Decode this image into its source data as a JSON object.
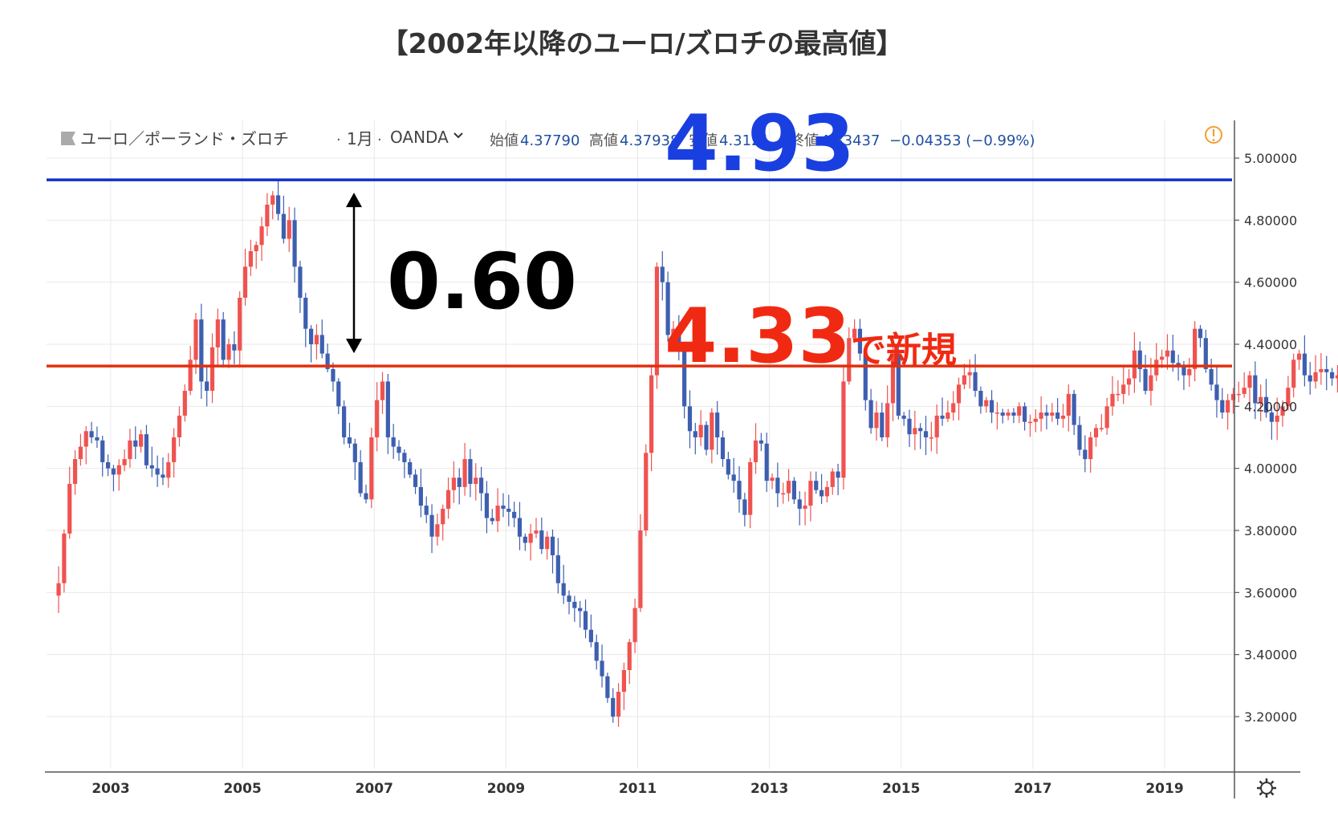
{
  "title": "【2002年以降のユーロ/ズロチの最高値】",
  "header": {
    "symbol": "ユーロ／ポーランド・ズロチ",
    "interval": "1月",
    "source": "OANDA",
    "open_label": "始値",
    "open_value": "4.37790",
    "high_label": "高値",
    "high_value": "4.37938",
    "low_label": "安値",
    "low_value": "4.3121",
    "close_label": "終値",
    "close_value": "4.33437",
    "change": "−0.04353 (−0.99%)"
  },
  "annotations": {
    "high_value": "4.93",
    "diff_value": "0.60",
    "current_value": "4.33",
    "current_suffix": "で新規"
  },
  "colors": {
    "up": "#ef5350",
    "down": "#3e5fb0",
    "high_line": "#1230c8",
    "current_line": "#e03010",
    "axis": "#555555",
    "grid": "#e8e8e8",
    "warning": "#f0a030"
  },
  "icons": {
    "warning": "warning-icon",
    "settings": "gear-icon",
    "flag": "flag-icon",
    "dropdown": "chevron-down-icon"
  },
  "chart_data": {
    "type": "candlestick",
    "interval": "monthly",
    "x_ticks": [
      "2003",
      "2005",
      "2007",
      "2009",
      "2011",
      "2013",
      "2015",
      "2017",
      "2019"
    ],
    "y_ticks": [
      "5.00000",
      "4.80000",
      "4.60000",
      "4.40000",
      "4.20000",
      "4.00000",
      "3.80000",
      "3.60000",
      "3.40000",
      "3.20000"
    ],
    "ylim": [
      3.05,
      5.05
    ],
    "xlim": [
      2001.6,
      2020.3
    ],
    "reference_lines": [
      {
        "value": 4.93,
        "color": "blue"
      },
      {
        "value": 4.33,
        "color": "red"
      }
    ],
    "start": "2002-03",
    "closes": [
      3.63,
      3.79,
      3.95,
      4.03,
      4.07,
      4.12,
      4.1,
      4.09,
      4.02,
      4.0,
      3.98,
      4.01,
      4.03,
      4.09,
      4.07,
      4.11,
      4.01,
      4.0,
      3.98,
      3.97,
      4.02,
      4.1,
      4.17,
      4.25,
      4.35,
      4.48,
      4.28,
      4.25,
      4.39,
      4.48,
      4.35,
      4.4,
      4.38,
      4.55,
      4.65,
      4.7,
      4.72,
      4.78,
      4.85,
      4.88,
      4.82,
      4.74,
      4.8,
      4.65,
      4.55,
      4.45,
      4.4,
      4.43,
      4.37,
      4.32,
      4.28,
      4.2,
      4.1,
      4.08,
      4.02,
      3.92,
      3.9,
      4.1,
      4.22,
      4.28,
      4.1,
      4.07,
      4.05,
      4.02,
      3.98,
      3.94,
      3.88,
      3.85,
      3.78,
      3.82,
      3.87,
      3.93,
      3.97,
      3.94,
      4.03,
      3.95,
      3.97,
      3.92,
      3.84,
      3.83,
      3.88,
      3.87,
      3.86,
      3.84,
      3.78,
      3.76,
      3.79,
      3.8,
      3.74,
      3.78,
      3.72,
      3.63,
      3.59,
      3.57,
      3.55,
      3.54,
      3.48,
      3.44,
      3.38,
      3.33,
      3.26,
      3.2,
      3.28,
      3.35,
      3.44,
      3.55,
      3.8,
      4.05,
      4.3,
      4.65,
      4.6,
      4.43,
      4.45,
      4.38,
      4.2,
      4.12,
      4.1,
      4.14,
      4.06,
      4.18,
      4.1,
      4.03,
      3.98,
      3.96,
      3.9,
      3.85,
      4.02,
      4.09,
      4.08,
      3.96,
      3.97,
      3.92,
      3.92,
      3.96,
      3.9,
      3.87,
      3.88,
      3.96,
      3.93,
      3.91,
      3.94,
      3.99,
      3.97,
      4.28,
      4.42,
      4.45,
      4.37,
      4.22,
      4.13,
      4.18,
      4.1,
      4.21,
      4.37,
      4.17,
      4.16,
      4.11,
      4.13,
      4.12,
      4.1,
      4.1,
      4.17,
      4.16,
      4.18,
      4.21,
      4.27,
      4.3,
      4.31,
      4.25,
      4.2,
      4.22,
      4.18,
      4.18,
      4.17,
      4.18,
      4.17,
      4.2,
      4.15,
      4.15,
      4.16,
      4.18,
      4.17,
      4.18,
      4.16,
      4.17,
      4.24,
      4.14,
      4.06,
      4.03,
      4.1,
      4.13,
      4.13,
      4.2,
      4.24,
      4.24,
      4.27,
      4.29,
      4.38,
      4.32,
      4.25,
      4.3,
      4.35,
      4.36,
      4.38,
      4.34,
      4.33,
      4.3,
      4.32,
      4.45,
      4.42,
      4.32,
      4.27,
      4.22,
      4.18,
      4.22,
      4.24,
      4.24,
      4.26,
      4.3,
      4.21,
      4.23,
      4.18,
      4.15,
      4.17,
      4.2,
      4.26,
      4.35,
      4.37,
      4.3,
      4.28,
      4.31,
      4.32,
      4.31,
      4.29,
      4.3,
      4.3,
      4.28,
      4.28,
      4.27,
      4.3,
      4.38,
      4.33
    ]
  }
}
